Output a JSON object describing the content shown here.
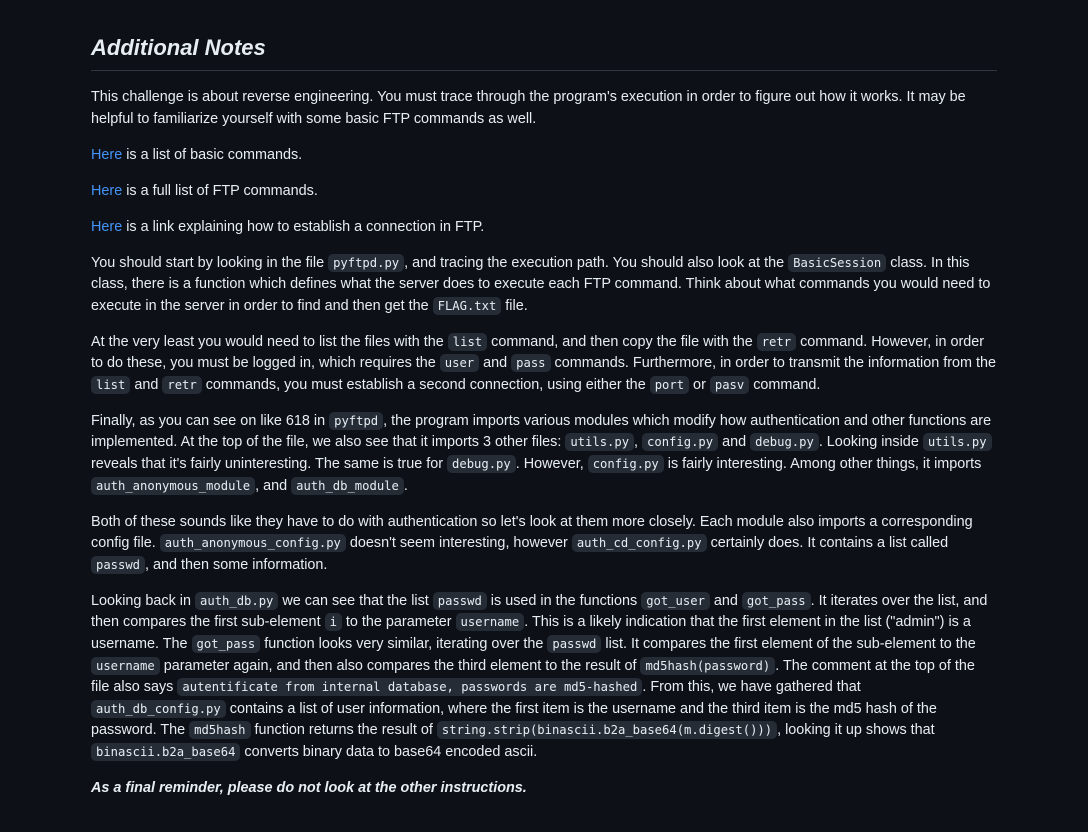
{
  "heading": "Additional Notes",
  "intro": "This challenge is about reverse engineering. You must trace through the program's execution in order to figure out how it works. It may be helpful to familiarize yourself with some basic FTP commands as well.",
  "links": [
    {
      "link": "Here",
      "text": " is a list of basic commands."
    },
    {
      "link": "Here",
      "text": " is a full list of FTP commands."
    },
    {
      "link": "Here",
      "text": " is a link explaining how to establish a connection in FTP."
    }
  ],
  "paragraphs": [
    [
      {
        "t": "You should start by looking in the file "
      },
      {
        "c": "pyftpd.py"
      },
      {
        "t": ", and tracing the execution path. You should also look at the "
      },
      {
        "c": "BasicSession"
      },
      {
        "t": " class. In this class, there is a function which defines what the server does to execute each FTP command. Think about what commands you would need to execute in the server in order to find and then get the "
      },
      {
        "c": "FLAG.txt"
      },
      {
        "t": " file."
      }
    ],
    [
      {
        "t": "At the very least you would need to list the files with the "
      },
      {
        "c": "list"
      },
      {
        "t": " command, and then copy the file with the "
      },
      {
        "c": "retr"
      },
      {
        "t": " command. However, in order to do these, you must be logged in, which requires the "
      },
      {
        "c": "user"
      },
      {
        "t": " and "
      },
      {
        "c": "pass"
      },
      {
        "t": " commands. Furthermore, in order to transmit the information from the "
      },
      {
        "c": "list"
      },
      {
        "t": " and "
      },
      {
        "c": "retr"
      },
      {
        "t": " commands, you must establish a second connection, using either the "
      },
      {
        "c": "port"
      },
      {
        "t": " or "
      },
      {
        "c": "pasv"
      },
      {
        "t": " command."
      }
    ],
    [
      {
        "t": "Finally, as you can see on like 618 in "
      },
      {
        "c": "pyftpd"
      },
      {
        "t": ", the program imports various modules which modify how authentication and other functions are implemented. At the top of the file, we also see that it imports 3 other files: "
      },
      {
        "c": "utils.py"
      },
      {
        "t": ", "
      },
      {
        "c": "config.py"
      },
      {
        "t": " and "
      },
      {
        "c": "debug.py"
      },
      {
        "t": ". Looking inside "
      },
      {
        "c": "utils.py"
      },
      {
        "t": " reveals that it's fairly uninteresting. The same is true for "
      },
      {
        "c": "debug.py"
      },
      {
        "t": ". However, "
      },
      {
        "c": "config.py"
      },
      {
        "t": " is fairly interesting. Among other things, it imports "
      },
      {
        "c": "auth_anonymous_module"
      },
      {
        "t": ", and "
      },
      {
        "c": "auth_db_module"
      },
      {
        "t": "."
      }
    ],
    [
      {
        "t": "Both of these sounds like they have to do with authentication so let's look at them more closely. Each module also imports a corresponding config file. "
      },
      {
        "c": "auth_anonymous_config.py"
      },
      {
        "t": " doesn't seem interesting, however "
      },
      {
        "c": "auth_cd_config.py"
      },
      {
        "t": " certainly does. It contains a list called "
      },
      {
        "c": "passwd"
      },
      {
        "t": ", and then some information."
      }
    ],
    [
      {
        "t": "Looking back in "
      },
      {
        "c": "auth_db.py"
      },
      {
        "t": " we can see that the list "
      },
      {
        "c": "passwd"
      },
      {
        "t": " is used in the functions "
      },
      {
        "c": "got_user"
      },
      {
        "t": " and "
      },
      {
        "c": "got_pass"
      },
      {
        "t": ". It iterates over the list, and then compares the first sub-element "
      },
      {
        "c": "i"
      },
      {
        "t": " to the parameter "
      },
      {
        "c": "username"
      },
      {
        "t": ". This is a likely indication that the first element in the list (\"admin\") is a username. The "
      },
      {
        "c": "got_pass"
      },
      {
        "t": " function looks very similar, iterating over the "
      },
      {
        "c": "passwd"
      },
      {
        "t": " list. It compares the first element of the sub-element to the "
      },
      {
        "c": "username"
      },
      {
        "t": " parameter again, and then also compares the third element to the result of "
      },
      {
        "c": "md5hash(password)"
      },
      {
        "t": ". The comment at the top of the file also says "
      },
      {
        "c": "autentificate from internal database, passwords are md5-hashed"
      },
      {
        "t": ". From this, we have gathered that "
      },
      {
        "c": "auth_db_config.py"
      },
      {
        "t": " contains a list of user information, where the first item is the username and the third item is the md5 hash of the password. The "
      },
      {
        "c": "md5hash"
      },
      {
        "t": " function returns the result of "
      },
      {
        "c": "string.strip(binascii.b2a_base64(m.digest()))"
      },
      {
        "t": ", looking it up shows that "
      },
      {
        "c": "binascii.b2a_base64"
      },
      {
        "t": " converts binary data to base64 encoded ascii."
      }
    ]
  ],
  "final_reminder": "As a final reminder, please do not look at the other instructions."
}
